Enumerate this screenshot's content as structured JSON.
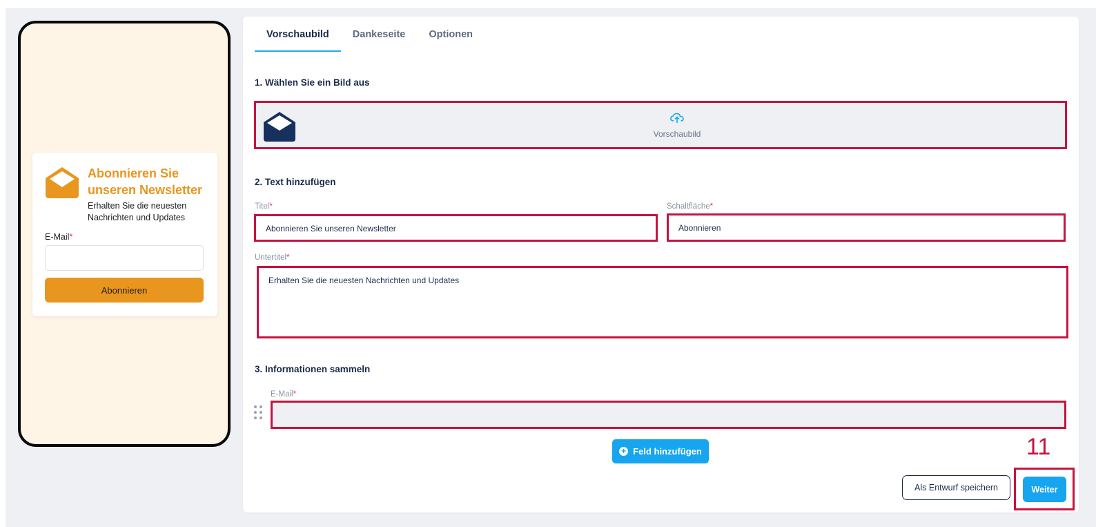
{
  "preview": {
    "title": "Abonnieren Sie unseren Newsletter",
    "subtitle": "Erhalten Sie die neuesten Nachrichten und Updates",
    "email_label": "E-Mail",
    "required_mark": "*",
    "button_label": "Abonnieren"
  },
  "tabs": [
    {
      "label": "Vorschaubild",
      "active": true
    },
    {
      "label": "Dankeseite",
      "active": false
    },
    {
      "label": "Optionen",
      "active": false
    }
  ],
  "sections": {
    "image": {
      "title": "1. Wählen Sie ein Bild aus",
      "upload_label": "Vorschaubild"
    },
    "text": {
      "title": "2. Text hinzufügen"
    },
    "collect": {
      "title": "3. Informationen sammeln"
    }
  },
  "fields": {
    "title": {
      "label": "Titel",
      "value": "Abonnieren Sie unseren Newsletter"
    },
    "button": {
      "label": "Schaltfläche",
      "value": "Abonnieren"
    },
    "subtitle": {
      "label": "Untertitel",
      "value": "Erhalten Sie die neuesten Nachrichten und Updates"
    },
    "email": {
      "label": "E-Mail"
    }
  },
  "actions": {
    "add_field": "Feld hinzufügen",
    "save_draft": "Als Entwurf speichern",
    "next": "Weiter"
  },
  "annotation": {
    "step_number": "11"
  },
  "colors": {
    "accent": "#16a5ee",
    "preview_orange": "#e8961e",
    "highlight_red": "#c8123f",
    "navy": "#1c2b4a"
  },
  "icons": {
    "preview_icon": "envelope-open-icon",
    "upload_icon": "cloud-upload-icon",
    "drag_icon": "drag-handle-icon",
    "add_icon": "plus-circle-icon"
  }
}
